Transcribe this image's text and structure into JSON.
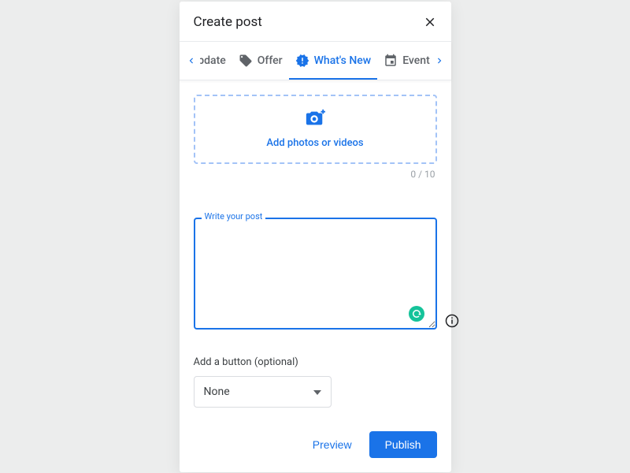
{
  "header": {
    "title": "Create post"
  },
  "tabs": {
    "items": [
      {
        "label": "update"
      },
      {
        "label": "Offer"
      },
      {
        "label": "What's New"
      },
      {
        "label": "Event"
      }
    ],
    "active_index": 2
  },
  "upload": {
    "label": "Add photos or videos",
    "counter": "0 / 10"
  },
  "post_field": {
    "label": "Write your post",
    "value": ""
  },
  "button_section": {
    "label": "Add a button (optional)",
    "selected": "None"
  },
  "footer": {
    "preview": "Preview",
    "publish": "Publish"
  }
}
